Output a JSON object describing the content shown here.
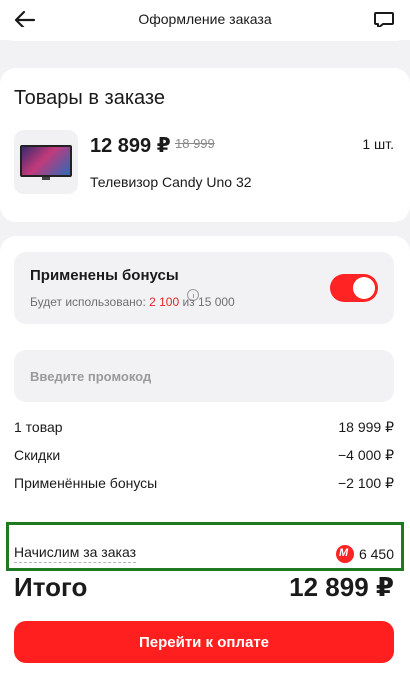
{
  "header": {
    "title": "Оформление заказа",
    "back_icon": "arrow-left-icon",
    "chat_icon": "chat-bubble-icon"
  },
  "items_section": {
    "title": "Товары в заказе",
    "product": {
      "price": "12 899 ₽",
      "old_price": "18 999",
      "quantity": "1 шт.",
      "name": "Телевизор Candy Uno 32"
    }
  },
  "bonuses": {
    "title": "Применены бонусы",
    "sub_prefix": "Будет использовано: ",
    "used": "2 100",
    "sub_mid": " из ",
    "available": "15 000",
    "toggle_on": true,
    "accent": "#ff2323"
  },
  "promo": {
    "placeholder": "Введите промокод"
  },
  "summary": {
    "rows": [
      {
        "label": "1 товар",
        "value": "18 999 ₽"
      },
      {
        "label": "Скидки",
        "value": "−4 000 ₽"
      },
      {
        "label": "Применённые бонусы",
        "value": "−2 100 ₽"
      }
    ],
    "accrual_label": "Начислим за заказ",
    "accrual_value": "6 450",
    "total_label": "Итого",
    "total_value": "12 899 ₽"
  },
  "pay_button": {
    "label": "Перейти к оплате"
  }
}
